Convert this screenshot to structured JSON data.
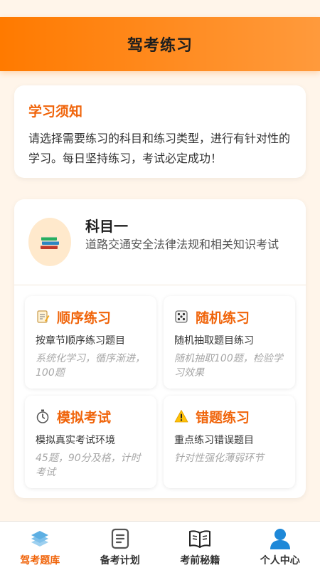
{
  "header": {
    "title": "驾考练习"
  },
  "notice": {
    "title": "学习须知",
    "text": "请选择需要练习的科目和练习类型，进行有针对性的学习。每日坚持练习，考试必定成功！"
  },
  "subject": {
    "icon": "books-icon",
    "name": "科目一",
    "description": "道路交通安全法律法规和相关知识考试"
  },
  "modes": [
    {
      "icon": "memo-icon",
      "title": "顺序练习",
      "subtitle": "按章节顺序练习题目",
      "note": "系统化学习，循序渐进，100题"
    },
    {
      "icon": "dice-icon",
      "title": "随机练习",
      "subtitle": "随机抽取题目练习",
      "note": "随机抽取100题，检验学习效果"
    },
    {
      "icon": "stopwatch-icon",
      "title": "模拟考试",
      "subtitle": "模拟真实考试环境",
      "note": "45题，90分及格，计时考试"
    },
    {
      "icon": "warning-icon",
      "title": "错题练习",
      "subtitle": "重点练习错误题目",
      "note": "针对性强化薄弱环节"
    }
  ],
  "tabs": [
    {
      "label": "驾考题库",
      "icon": "question-bank-icon",
      "active": true
    },
    {
      "label": "备考计划",
      "icon": "plan-icon",
      "active": false
    },
    {
      "label": "考前秘籍",
      "icon": "open-book-icon",
      "active": false
    },
    {
      "label": "个人中心",
      "icon": "person-icon",
      "active": false
    }
  ],
  "colors": {
    "accent": "#F0640A",
    "header_start": "#FF7A00",
    "header_end": "#FF9A3C",
    "background": "#FFF5EA",
    "tab_icon_active": "#6BB8E8",
    "person_icon": "#1E88D8"
  }
}
